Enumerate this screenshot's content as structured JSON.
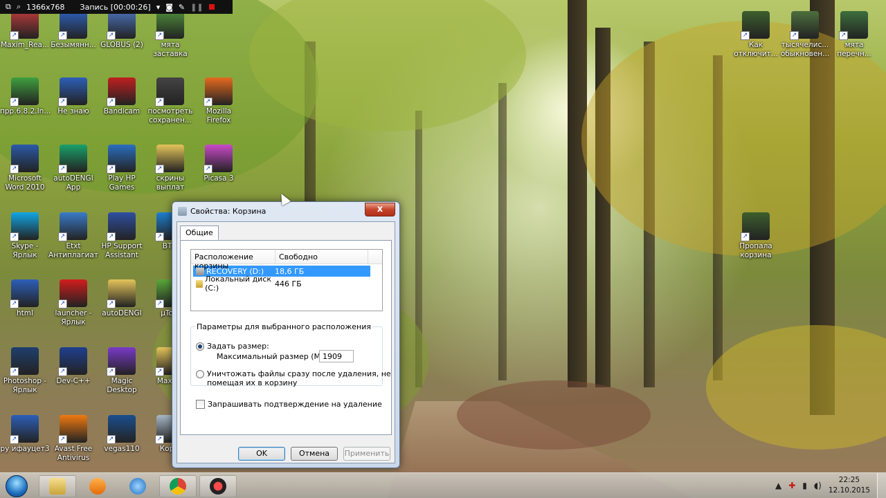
{
  "recorder": {
    "resolution": "1366x768",
    "status": "Запись [00:00:26]"
  },
  "desktop_icons": [
    {
      "label": "Maxim_Rea...",
      "icon": "app-icon",
      "color": "#b43a3a"
    },
    {
      "label": "Безымянн...",
      "icon": "word-doc-icon",
      "color": "#2d5fb8"
    },
    {
      "label": "GLOBUS (2)",
      "icon": "globus-icon",
      "color": "#4a6fb5"
    },
    {
      "label": "мята заставка",
      "icon": "video-icon",
      "color": "#4d8a3a"
    },
    {
      "label": "прр.6.8.2.In...",
      "icon": "frog-icon",
      "color": "#3f9f3f"
    },
    {
      "label": "Не знаю",
      "icon": "word-doc-icon",
      "color": "#2d5fb8"
    },
    {
      "label": "Bandicam",
      "icon": "bandicam-icon",
      "color": "#c02020"
    },
    {
      "label": "посмотреть сохранен...",
      "icon": "video-icon",
      "color": "#444444"
    },
    {
      "label": "Mozilla Firefox",
      "icon": "firefox-icon",
      "color": "#e66a1f"
    },
    {
      "label": "Microsoft Word 2010",
      "icon": "word-icon",
      "color": "#2b5aa7"
    },
    {
      "label": "autoDENGI App",
      "icon": "autodengi-icon",
      "color": "#1aa06a"
    },
    {
      "label": "Play HP Games",
      "icon": "hp-games-icon",
      "color": "#2a6fc0"
    },
    {
      "label": "скрины выплат",
      "icon": "folder-icon",
      "color": "#e4c45a"
    },
    {
      "label": "Picasa 3",
      "icon": "picasa-icon",
      "color": "#c94ac9"
    },
    {
      "label": "Skype - Ярлык",
      "icon": "skype-icon",
      "color": "#12a5e3"
    },
    {
      "label": "Etxt Антиплагиат",
      "icon": "etxt-icon",
      "color": "#3a7bc8"
    },
    {
      "label": "HP Support Assistant",
      "icon": "hp-support-icon",
      "color": "#2f4fa0"
    },
    {
      "label": "BT...",
      "icon": "app-icon",
      "color": "#1e7fd0"
    },
    {
      "label": "html",
      "icon": "word-doc-icon",
      "color": "#2d5fb8"
    },
    {
      "label": "launcher - Ярлык",
      "icon": "opera-icon",
      "color": "#d11d1d"
    },
    {
      "label": "autoDENGI",
      "icon": "folder-icon",
      "color": "#e4c45a"
    },
    {
      "label": "µTo...",
      "icon": "utorrent-icon",
      "color": "#5aa83a"
    },
    {
      "label": "Photoshop - Ярлык",
      "icon": "photoshop-icon",
      "color": "#1f3f6e"
    },
    {
      "label": "Dev-C++",
      "icon": "devcpp-icon",
      "color": "#1f3f8e"
    },
    {
      "label": "Magic Desktop",
      "icon": "magic-desktop-icon",
      "color": "#7a3ac8"
    },
    {
      "label": "Maxa...",
      "icon": "folder-icon",
      "color": "#e4c45a"
    },
    {
      "label": "ру ифауцет3",
      "icon": "word-doc-icon",
      "color": "#2d5fb8"
    },
    {
      "label": "Avast Free Antivirus",
      "icon": "avast-icon",
      "color": "#f07a10"
    },
    {
      "label": "vegas110",
      "icon": "vegas-icon",
      "color": "#1a4f8e"
    },
    {
      "label": "Кор...",
      "icon": "recycle-bin-icon",
      "color": "#a8b8c8"
    },
    {
      "label": "Как отключит...",
      "icon": "video-icon",
      "color": "#3d5f2d"
    },
    {
      "label": "тысячелис... обыкновен...",
      "icon": "video-icon",
      "color": "#4d6f3d"
    },
    {
      "label": "мята перечн...",
      "icon": "video-icon",
      "color": "#3d6f3d"
    },
    {
      "label": "Пропала корзина",
      "icon": "video-icon",
      "color": "#3d5f2d"
    }
  ],
  "dialog": {
    "title": "Свойства: Корзина",
    "close": "x",
    "tab": "Общие",
    "list": {
      "col_location": "Расположение корзины",
      "col_free": "Свободно",
      "rows": [
        {
          "location": "RECOVERY (D:)",
          "free": "18,6 ГБ",
          "selected": true
        },
        {
          "location": "Локальный диск (C:)",
          "free": "446 ГБ",
          "selected": false
        }
      ]
    },
    "group_label": "Параметры для выбранного расположения",
    "radio_custom": "Задать размер:",
    "max_size_label": "Максимальный размер (МБ):",
    "max_size_value": "1909",
    "radio_delete_line1": "Уничтожать файлы сразу после удаления, не",
    "radio_delete_line2": "помещая их в корзину",
    "checkbox_confirm": "Запрашивать подтверждение на удаление",
    "ok": "OK",
    "cancel": "Отмена",
    "apply": "Применить"
  },
  "tray": {
    "time": "22:25",
    "date": "12.10.2015"
  }
}
